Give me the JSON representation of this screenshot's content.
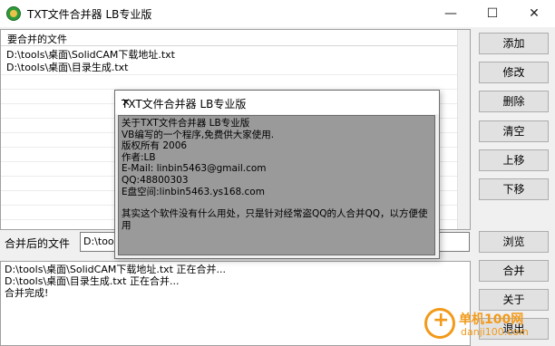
{
  "window": {
    "title": "TXT文件合并器 LB专业版",
    "min_icon": "minimize-icon",
    "max_icon": "maximize-icon",
    "close_icon": "close-icon"
  },
  "file_list": {
    "header": "要合并的文件",
    "items": [
      "D:\\tools\\桌面\\SolidCAM下载地址.txt",
      "D:\\tools\\桌面\\目录生成.txt"
    ]
  },
  "buttons": {
    "add": "添加",
    "modify": "修改",
    "delete": "删除",
    "clear": "清空",
    "up": "上移",
    "down": "下移",
    "browse": "浏览",
    "merge": "合并",
    "about": "关于",
    "exit": "退出"
  },
  "output": {
    "label": "合并后的文件",
    "value": "D:\\tools"
  },
  "log": {
    "lines": [
      "D:\\tools\\桌面\\SolidCAM下载地址.txt 正在合并...",
      "D:\\tools\\桌面\\目录生成.txt 正在合并...",
      "合并完成!"
    ]
  },
  "about_dialog": {
    "title": "TXT文件合并器 LB专业版",
    "lines": [
      "关于TXT文件合并器 LB专业版",
      "VB编写的一个程序,免费供大家使用.",
      "版权所有 2006",
      "作者:LB",
      "E-Mail: linbin5463@gmail.com",
      "QQ:48800303",
      "E盘空间:linbin5463.ys168.com"
    ],
    "note": "其实这个软件没有什么用处，只是针对经常盗QQ的人合并QQ，以方便使用"
  },
  "watermark": {
    "text": "单机100网",
    "sub": "danji100.com"
  }
}
